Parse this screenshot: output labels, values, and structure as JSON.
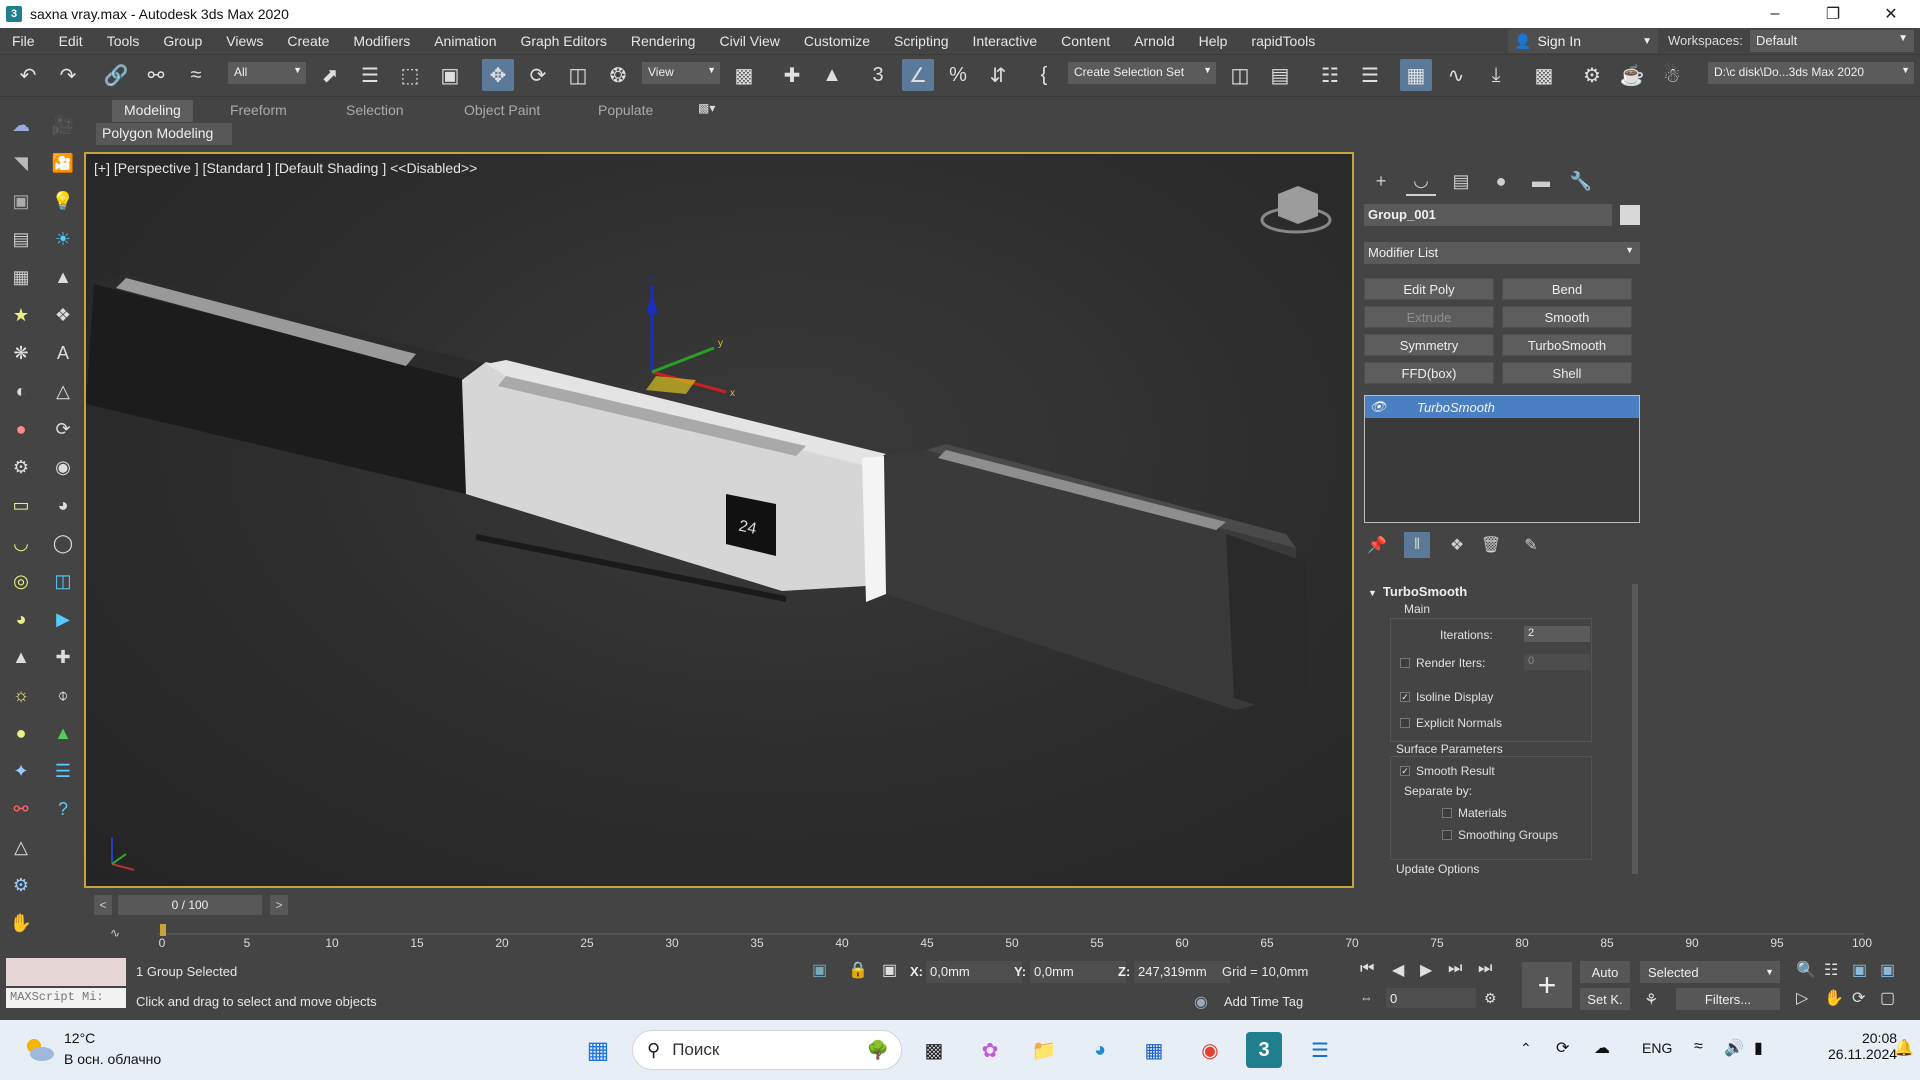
{
  "window": {
    "title": "saxna vray.max - Autodesk 3ds Max 2020",
    "app_icon": "3"
  },
  "menu": [
    "File",
    "Edit",
    "Tools",
    "Group",
    "Views",
    "Create",
    "Modifiers",
    "Animation",
    "Graph Editors",
    "Rendering",
    "Civil View",
    "Customize",
    "Scripting",
    "Interactive",
    "Content",
    "Arnold",
    "Help",
    "rapidTools"
  ],
  "account": {
    "sign_in": "Sign In",
    "workspaces_label": "Workspaces:",
    "workspace": "Default"
  },
  "toolbar": {
    "selection_filter": "All",
    "ref_coord": "View",
    "named_selection": "Create Selection Set",
    "project_path": "D:\\c disk\\Do...3ds Max 2020",
    "snap_angle_label": "3"
  },
  "ribbon": {
    "tabs": [
      "Modeling",
      "Freeform",
      "Selection",
      "Object Paint",
      "Populate"
    ],
    "active_tab": "Modeling",
    "panel": "Polygon Modeling"
  },
  "viewport": {
    "label": "[+] [Perspective ] [Standard ] [Default Shading ] <<Disabled>>",
    "panel_text": "24",
    "gizmo_axis_z": "z",
    "gizmo_axis_x": "x",
    "gizmo_axis_y": "y"
  },
  "command_panel": {
    "object_name": "Group_001",
    "object_color": "#d8d8d8",
    "modifier_list": "Modifier List",
    "modifier_buttons": [
      {
        "label": "Edit Poly",
        "enabled": true
      },
      {
        "label": "Bend",
        "enabled": true
      },
      {
        "label": "Extrude",
        "enabled": false
      },
      {
        "label": "Smooth",
        "enabled": true
      },
      {
        "label": "Symmetry",
        "enabled": true
      },
      {
        "label": "TurboSmooth",
        "enabled": true
      },
      {
        "label": "FFD(box)",
        "enabled": true
      },
      {
        "label": "Shell",
        "enabled": true
      }
    ],
    "stack_item": "TurboSmooth"
  },
  "turbosmooth": {
    "title": "TurboSmooth",
    "main_label": "Main",
    "iterations_label": "Iterations:",
    "iterations": "2",
    "render_iters_label": "Render Iters:",
    "render_iters": "0",
    "isoline_display": "Isoline Display",
    "explicit_normals": "Explicit Normals",
    "surface_params": "Surface Parameters",
    "smooth_result": "Smooth Result",
    "separate_by": "Separate by:",
    "materials": "Materials",
    "smoothing_groups": "Smoothing Groups",
    "update_options": "Update Options"
  },
  "timeline": {
    "frame_display": "0 / 100",
    "prev": "<",
    "next": ">",
    "ticks": [
      "0",
      "5",
      "10",
      "15",
      "20",
      "25",
      "30",
      "35",
      "40",
      "45",
      "50",
      "55",
      "60",
      "65",
      "70",
      "75",
      "80",
      "85",
      "90",
      "95",
      "100"
    ]
  },
  "status": {
    "maxscript": "MAXScript Mi:",
    "selection": "1 Group Selected",
    "prompt": "Click and drag to select and move objects",
    "x_label": "X:",
    "x": "0,0mm",
    "y_label": "Y:",
    "y": "0,0mm",
    "z_label": "Z:",
    "z": "247,319mm",
    "grid": "Grid = 10,0mm",
    "add_time_tag": "Add Time Tag",
    "auto": "Auto",
    "set_key": "Set K.",
    "selected": "Selected",
    "filters": "Filters...",
    "frame": "0"
  },
  "taskbar": {
    "temp": "12°C",
    "weather": "В осн. облачно",
    "search": "Поиск",
    "lang": "ENG",
    "time": "20:08",
    "date": "26.11.2024"
  }
}
